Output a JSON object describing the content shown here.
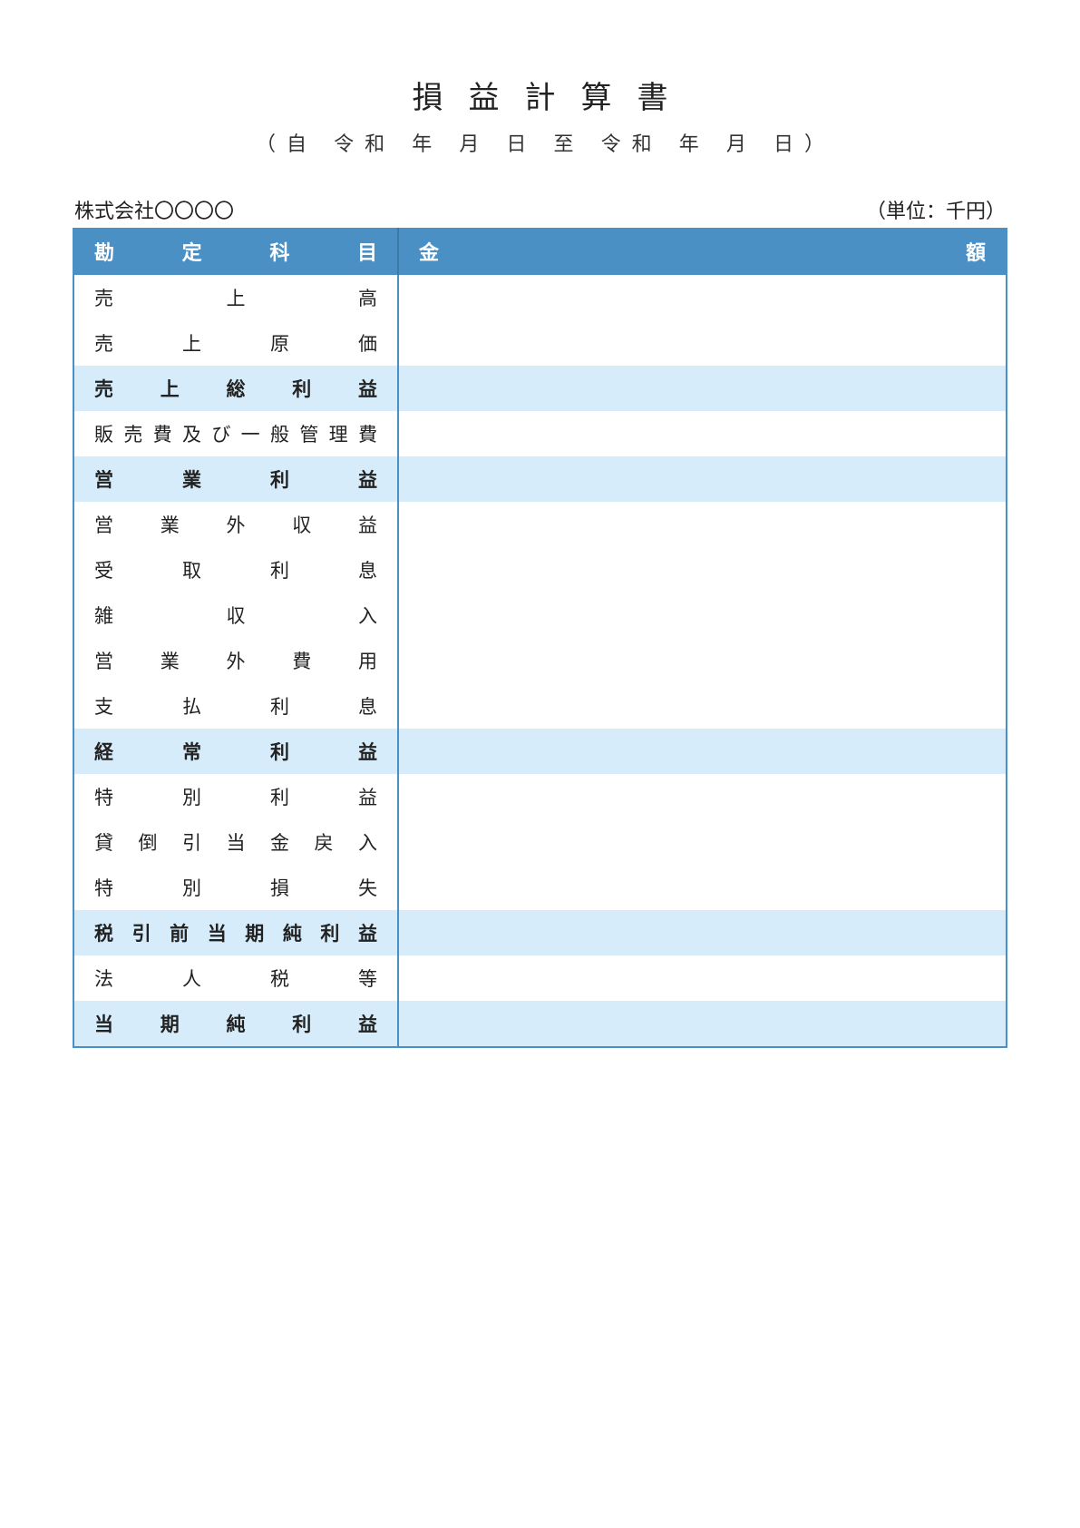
{
  "title": "損益計算書",
  "subtitle": "（自 令和 年 月 日  至 令和 年 月 日）",
  "company": "株式会社〇〇〇〇",
  "unit": "（単位：千円）",
  "header": {
    "col1": "勘定科目",
    "col2": "金額"
  },
  "rows": [
    {
      "label": "売上高",
      "amount": "",
      "highlight": false
    },
    {
      "label": "売上原価",
      "amount": "",
      "highlight": false
    },
    {
      "label": "売上総利益",
      "amount": "",
      "highlight": true
    },
    {
      "label": "販売費及び一般管理費",
      "amount": "",
      "highlight": false
    },
    {
      "label": "営業利益",
      "amount": "",
      "highlight": true
    },
    {
      "label": "営業外収益",
      "amount": "",
      "highlight": false
    },
    {
      "label": "受取利息",
      "amount": "",
      "highlight": false
    },
    {
      "label": "雑収入",
      "amount": "",
      "highlight": false
    },
    {
      "label": "営業外費用",
      "amount": "",
      "highlight": false
    },
    {
      "label": "支払利息",
      "amount": "",
      "highlight": false
    },
    {
      "label": "経常利益",
      "amount": "",
      "highlight": true
    },
    {
      "label": "特別利益",
      "amount": "",
      "highlight": false
    },
    {
      "label": "貸倒引当金戻入",
      "amount": "",
      "highlight": false
    },
    {
      "label": "特別損失",
      "amount": "",
      "highlight": false
    },
    {
      "label": "税引前当期純利益",
      "amount": "",
      "highlight": true
    },
    {
      "label": "法人税等",
      "amount": "",
      "highlight": false
    },
    {
      "label": "当期純利益",
      "amount": "",
      "highlight": true
    }
  ]
}
